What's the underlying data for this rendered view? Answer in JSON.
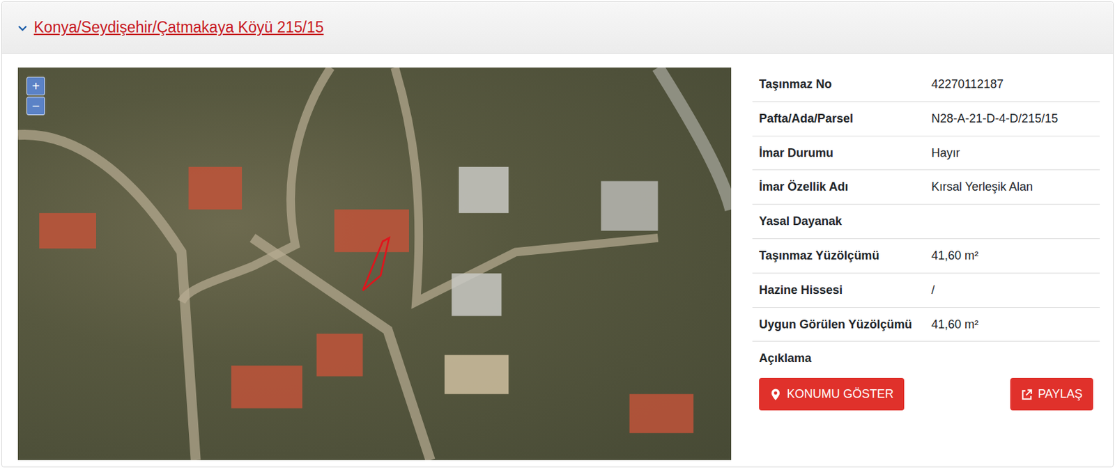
{
  "header": {
    "title": "Konya/Seydişehir/Çatmakaya Köyü 215/15"
  },
  "map": {
    "zoom_in": "+",
    "zoom_out": "−"
  },
  "details": [
    {
      "label": "Taşınmaz No",
      "value": "42270112187"
    },
    {
      "label": "Pafta/Ada/Parsel",
      "value": "N28-A-21-D-4-D/215/15"
    },
    {
      "label": "İmar Durumu",
      "value": "Hayır"
    },
    {
      "label": "İmar Özellik Adı",
      "value": "Kırsal Yerleşik Alan"
    },
    {
      "label": "Yasal Dayanak",
      "value": ""
    },
    {
      "label": "Taşınmaz Yüzölçümü",
      "value": "41,60 m²"
    },
    {
      "label": "Hazine Hissesi",
      "value": "/"
    },
    {
      "label": "Uygun Görülen Yüzölçümü",
      "value": "41,60 m²"
    },
    {
      "label": "Açıklama",
      "value": ""
    }
  ],
  "buttons": [
    {
      "label": "KONUMU GÖSTER",
      "kind": "location"
    },
    {
      "label": "PAYLAŞ",
      "kind": "share"
    }
  ]
}
